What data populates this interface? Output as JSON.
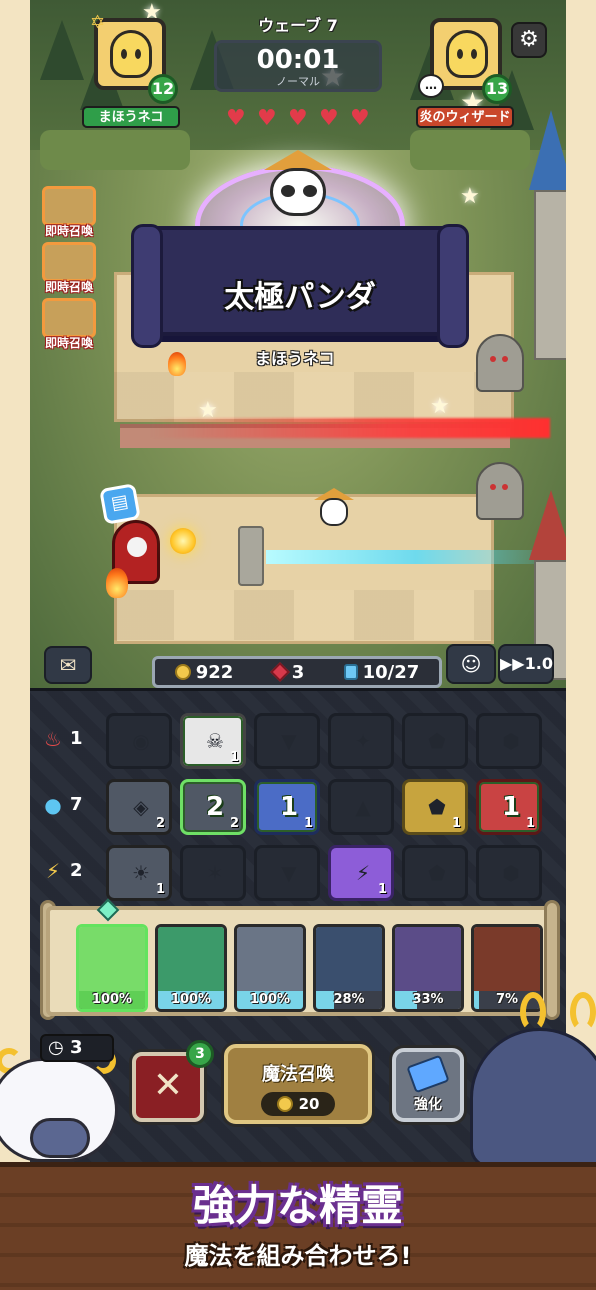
{
  "colors": {
    "accent_green": "#37a548",
    "player_tag": "#2f9e49",
    "enemy_tag": "#c9472b",
    "instant_border": "#f39a3e",
    "promo_outline": "#6a2f8f"
  },
  "header": {
    "wave_label": "ウェーブ 7",
    "timer": "00:01",
    "mode": "ノーマル",
    "settings_icon": "gear-icon"
  },
  "player": {
    "name": "まほうネコ",
    "level": "12"
  },
  "opponent": {
    "name": "炎のウィザード",
    "level": "13",
    "chat": "…"
  },
  "summon_event": {
    "unit_name": "太極パンダ",
    "owner": "まほうネコ"
  },
  "hearts": 5,
  "instant_summons": [
    {
      "label": "即時召喚"
    },
    {
      "label": "即時召喚"
    },
    {
      "label": "即時召喚"
    }
  ],
  "resources": {
    "gold": "922",
    "ruby": "3",
    "units": "10/27"
  },
  "speed": "1.0",
  "elements": {
    "fire": {
      "count": "1",
      "slots": [
        {
          "style": "dim",
          "glyph": "◉",
          "n": ""
        },
        {
          "style": "green lit white",
          "glyph": "☠",
          "n": "1"
        },
        {
          "style": "dim",
          "glyph": "▼",
          "n": ""
        },
        {
          "style": "dim",
          "glyph": "✦",
          "n": ""
        },
        {
          "style": "dim",
          "glyph": "⬟",
          "n": ""
        },
        {
          "style": "dim",
          "glyph": "⬢",
          "n": ""
        }
      ]
    },
    "water": {
      "count": "7",
      "slots": [
        {
          "style": "lit",
          "glyph": "◈",
          "n": "2"
        },
        {
          "style": "green lit",
          "glyph": "2",
          "n": "2"
        },
        {
          "style": "green blue",
          "glyph": "1",
          "n": "1"
        },
        {
          "style": "dim",
          "glyph": "▲",
          "n": ""
        },
        {
          "style": "gold",
          "glyph": "⬟",
          "n": "1"
        },
        {
          "style": "green red",
          "glyph": "1",
          "n": "1"
        }
      ]
    },
    "lightning": {
      "count": "2",
      "slots": [
        {
          "style": "lit",
          "glyph": "☀",
          "n": "1"
        },
        {
          "style": "dim",
          "glyph": "✶",
          "n": ""
        },
        {
          "style": "dim",
          "glyph": "▼",
          "n": ""
        },
        {
          "style": "purple",
          "glyph": "⚡",
          "n": "1"
        },
        {
          "style": "dim",
          "glyph": "⬟",
          "n": ""
        },
        {
          "style": "dim",
          "glyph": "⬢",
          "n": ""
        }
      ]
    }
  },
  "cards": [
    {
      "pct": "100%",
      "fill": 1.0,
      "art": "#7a9a55",
      "selected": true
    },
    {
      "pct": "100%",
      "fill": 1.0,
      "art": "#3c9a6a"
    },
    {
      "pct": "100%",
      "fill": 1.0,
      "art": "#6a7586"
    },
    {
      "pct": "28%",
      "fill": 0.28,
      "art": "#3a4f6e"
    },
    {
      "pct": "33%",
      "fill": 0.33,
      "art": "#5b4c88"
    },
    {
      "pct": "7%",
      "fill": 0.07,
      "art": "#7a3a2a"
    }
  ],
  "actions": {
    "timer_chip": "3",
    "cancel_label": "✕",
    "cancel_badge": "3",
    "summon_label": "魔法召喚",
    "summon_cost": "20",
    "upgrade_label": "強化"
  },
  "promo": {
    "title": "強力な精霊",
    "subtitle": "魔法を組み合わせろ!"
  }
}
